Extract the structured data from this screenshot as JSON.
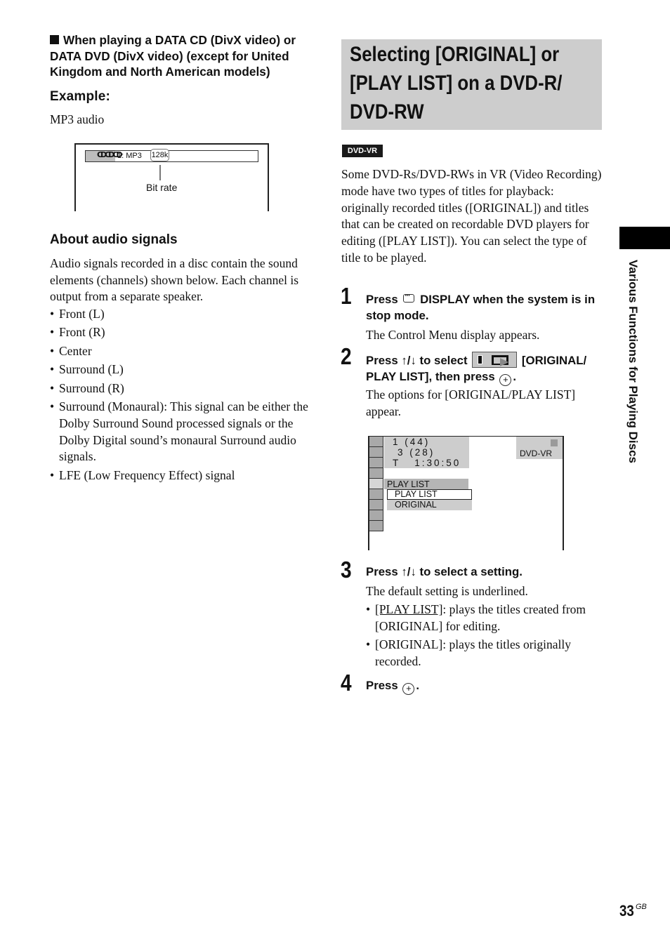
{
  "left": {
    "heading_marker": "■",
    "heading": "When playing a DATA CD (DivX video) or DATA DVD (DivX video) (except for United Kingdom and North American models)",
    "example_label": "Example:",
    "example_caption": "MP3 audio",
    "osd": {
      "disc_icon": "ↀↀↀ",
      "track": "1: MP3",
      "bit_rate_value": "128k",
      "callout_label": "Bit rate"
    },
    "about_heading": "About audio signals",
    "about_paragraph": "Audio signals recorded in a disc contain the sound elements (channels) shown below. Each channel is output from a separate speaker.",
    "channels": [
      "Front (L)",
      "Front (R)",
      "Center",
      "Surround (L)",
      "Surround (R)",
      "Surround (Monaural): This signal can be either the Dolby Surround Sound processed signals or the Dolby Digital sound’s monaural Surround audio signals.",
      "LFE (Low Frequency Effect) signal"
    ]
  },
  "right": {
    "section_title": "Selecting [ORIGINAL] or [PLAY LIST] on a DVD-R/ DVD-RW",
    "badge": "DVD-VR",
    "intro": "Some DVD-Rs/DVD-RWs in VR (Video Recording) mode have two types of titles for playback: originally recorded titles ([ORIGINAL]) and titles that can be created on recordable DVD players for editing ([PLAY LIST]). You can select the type of title to be played.",
    "steps": [
      {
        "number": "1",
        "head_pre": "Press",
        "head_icon": "display-icon",
        "head_post": "DISPLAY when the system is in stop mode.",
        "body": "The Control Menu display appears."
      },
      {
        "number": "2",
        "head_pre": "Press ↑/↓ to select",
        "head_icon": "original-play-list-menu-icon",
        "head_mid": "[ORIGINAL/ PLAY LIST], then press",
        "head_enter": "+",
        "head_post": ".",
        "body": "The options for [ORIGINAL/PLAY LIST] appear."
      },
      {
        "number": "3",
        "head": "Press ↑/↓ to select a setting.",
        "body": "The default setting is underlined.",
        "options": [
          {
            "name": "[PLAY LIST]",
            "desc": ": plays the titles created from [ORIGINAL] for editing.",
            "default": true
          },
          {
            "name": "[ORIGINAL]",
            "desc": ": plays the titles originally recorded.",
            "default": false
          }
        ]
      },
      {
        "number": "4",
        "head_pre": "Press",
        "head_enter": "+",
        "head_post": "."
      }
    ],
    "osd": {
      "info_lines": [
        "1 (44)",
        "3 (28)",
        "T   1:30:50"
      ],
      "disc_type": "DVD-VR",
      "menu_title": "PLAY LIST",
      "options": [
        "PLAY LIST",
        "ORIGINAL"
      ],
      "selected_option": "PLAY LIST"
    }
  },
  "side_tab": "Various Functions for Playing Discs",
  "page": {
    "number": "33",
    "suffix": "GB"
  }
}
